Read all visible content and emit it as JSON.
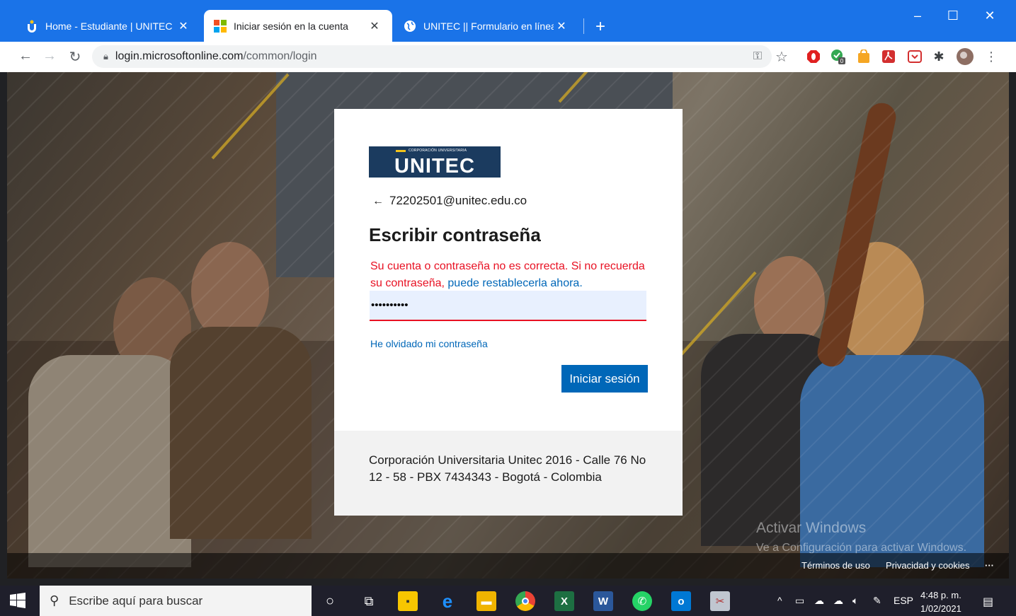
{
  "tabs": [
    {
      "title": "Home - Estudiante | UNITEC",
      "favicon": "unitec-u-icon",
      "active": false
    },
    {
      "title": "Iniciar sesión en la cuenta",
      "favicon": "microsoft-icon",
      "active": true
    },
    {
      "title": "UNITEC || Formulario en línea",
      "favicon": "globe-icon",
      "active": false
    }
  ],
  "window_controls": {
    "minimize": "–",
    "maximize": "☐",
    "close": "✕"
  },
  "url": {
    "host": "login.microsoftonline.com",
    "path": "/common/login"
  },
  "extensions_badge": "0",
  "login": {
    "logo_small": "CORPORACIÓN UNIVERSITARIA",
    "logo_word": "UNITEC",
    "identity": "72202501@unitec.edu.co",
    "heading": "Escribir contraseña",
    "error_text": "Su cuenta o contraseña no es correcta. Si no recuerda su contraseña, ",
    "error_link": "puede restablecerla ahora.",
    "password_value": "••••••••••",
    "forgot": "He olvidado mi contraseña",
    "signin_button": "Iniciar sesión",
    "footer_text": "Corporación Universitaria Unitec 2016 - Calle 76 No 12 - 58 - PBX 7434343 - Bogotá - Colombia"
  },
  "page_footer": {
    "terms": "Términos de uso",
    "privacy": "Privacidad y cookies",
    "more": "···"
  },
  "watermark": {
    "line1": "Activar Windows",
    "line2": "Ve a Configuración para activar Windows."
  },
  "taskbar": {
    "search_placeholder": "Escribe aquí para buscar",
    "language": "ESP",
    "time": "4:48 p. m.",
    "date": "1/02/2021"
  },
  "colors": {
    "chrome_blue": "#1a73e8",
    "ms_blue": "#0067b8",
    "error_red": "#e81123",
    "unitec_navy": "#1b3b5f"
  }
}
